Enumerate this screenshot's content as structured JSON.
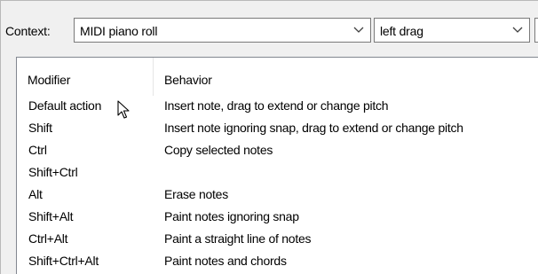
{
  "context": {
    "label": "Context:",
    "selected": "MIDI piano roll"
  },
  "action": {
    "selected": "left drag"
  },
  "table": {
    "headers": {
      "modifier": "Modifier",
      "behavior": "Behavior"
    },
    "rows": [
      {
        "modifier": "Default action",
        "behavior": "Insert note, drag to extend or change pitch"
      },
      {
        "modifier": "Shift",
        "behavior": "Insert note ignoring snap, drag to extend or change pitch"
      },
      {
        "modifier": "Ctrl",
        "behavior": "Copy selected notes"
      },
      {
        "modifier": "Shift+Ctrl",
        "behavior": ""
      },
      {
        "modifier": "Alt",
        "behavior": "Erase notes"
      },
      {
        "modifier": "Shift+Alt",
        "behavior": "Paint notes ignoring snap"
      },
      {
        "modifier": "Ctrl+Alt",
        "behavior": "Paint a straight line of notes"
      },
      {
        "modifier": "Shift+Ctrl+Alt",
        "behavior": "Paint notes and chords"
      }
    ]
  },
  "icons": {
    "combo_arrow": "chevron-down-icon",
    "cursor": "mouse-pointer-icon"
  }
}
